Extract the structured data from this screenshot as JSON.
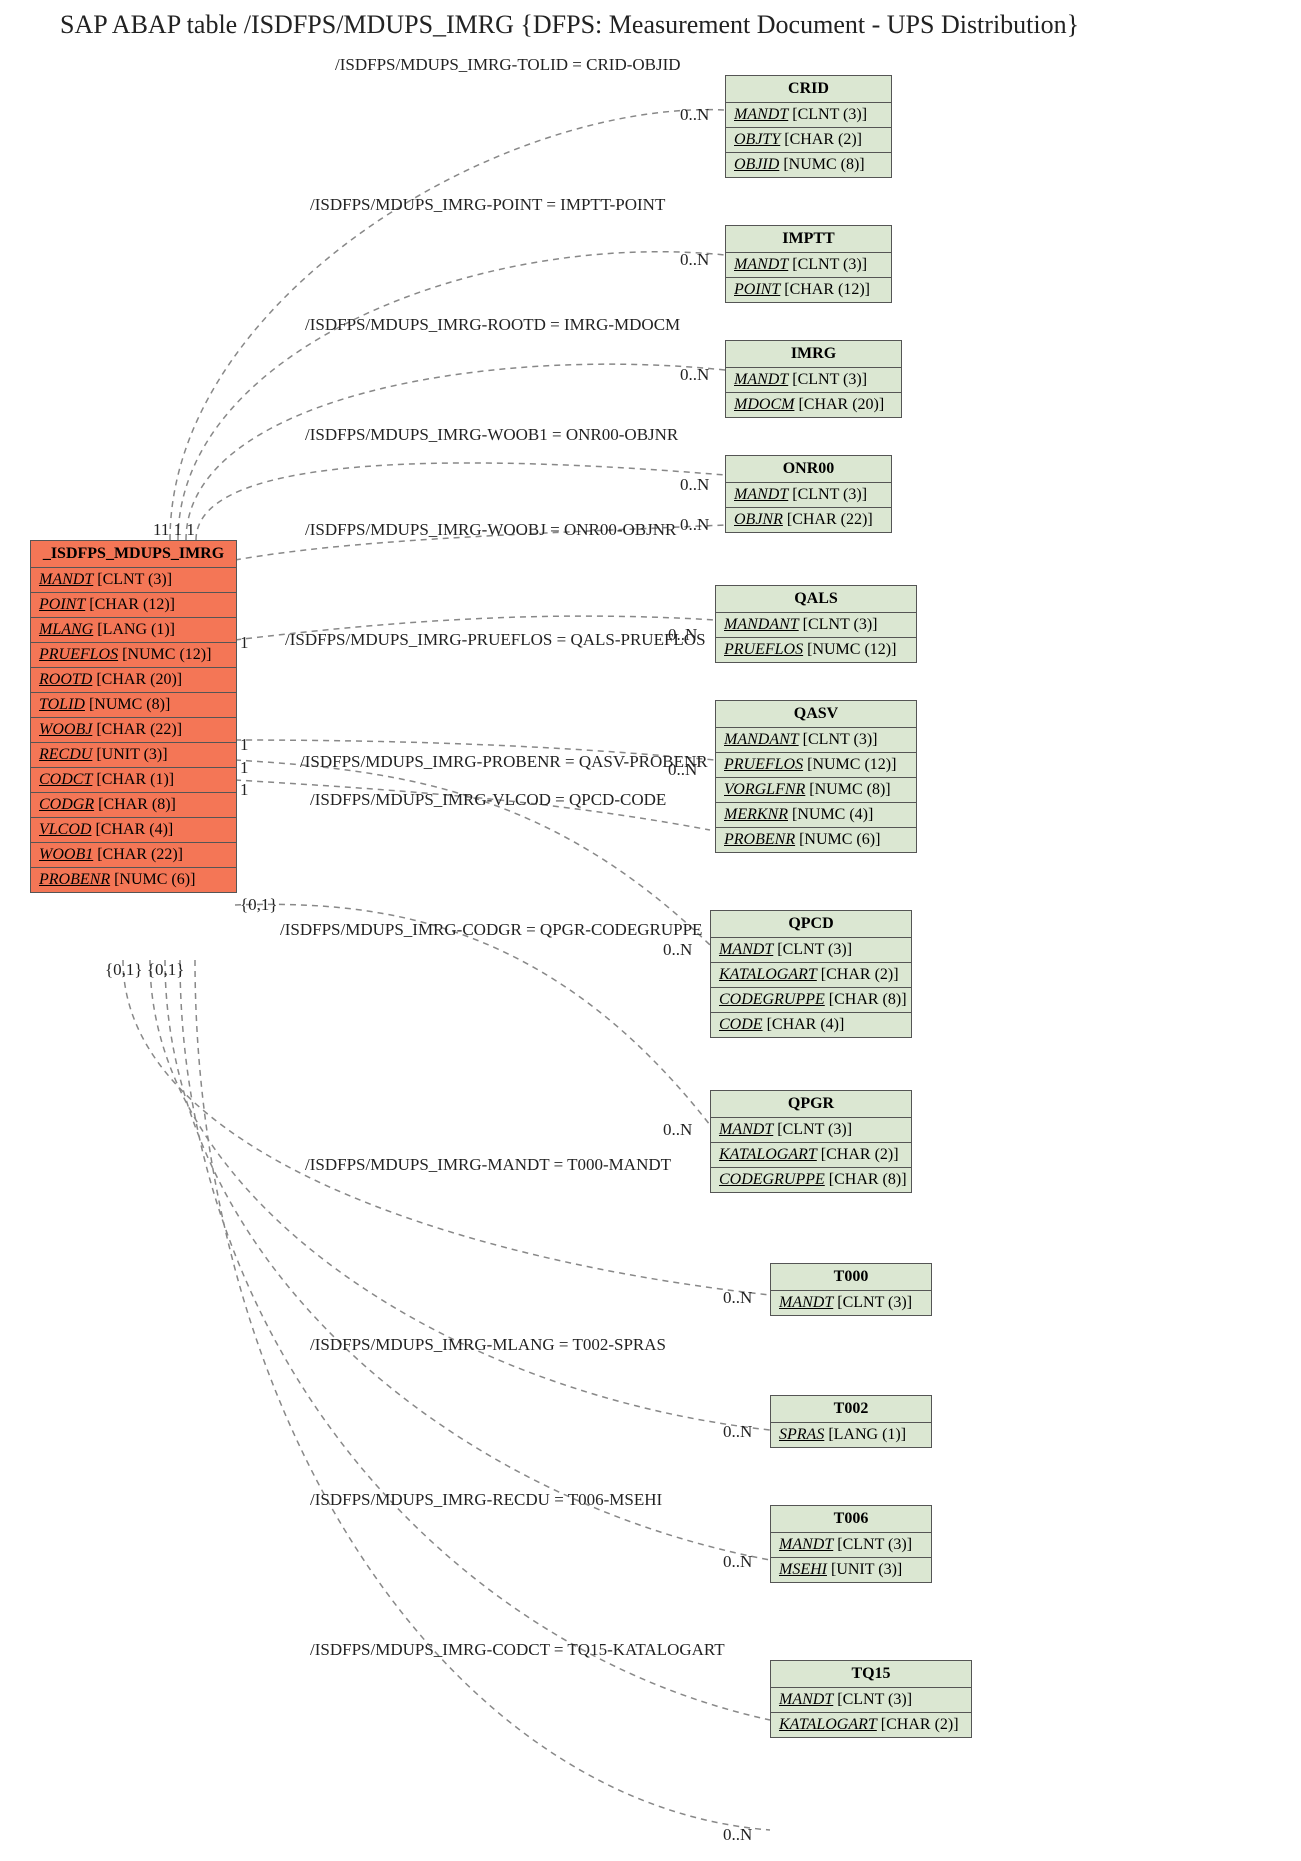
{
  "title": "SAP ABAP table /ISDFPS/MDUPS_IMRG {DFPS: Measurement Document - UPS Distribution}",
  "main_entity": {
    "name": "_ISDFPS_MDUPS_IMRG",
    "fields": [
      {
        "name": "MANDT",
        "type": "[CLNT (3)]",
        "key": true
      },
      {
        "name": "POINT",
        "type": "[CHAR (12)]",
        "key": true
      },
      {
        "name": "MLANG",
        "type": "[LANG (1)]",
        "key": true
      },
      {
        "name": "PRUEFLOS",
        "type": "[NUMC (12)]",
        "key": true
      },
      {
        "name": "ROOTD",
        "type": "[CHAR (20)]",
        "key": true
      },
      {
        "name": "TOLID",
        "type": "[NUMC (8)]",
        "key": true
      },
      {
        "name": "WOOBJ",
        "type": "[CHAR (22)]",
        "key": true
      },
      {
        "name": "RECDU",
        "type": "[UNIT (3)]",
        "key": true
      },
      {
        "name": "CODCT",
        "type": "[CHAR (1)]",
        "key": true
      },
      {
        "name": "CODGR",
        "type": "[CHAR (8)]",
        "key": true
      },
      {
        "name": "VLCOD",
        "type": "[CHAR (4)]",
        "key": true
      },
      {
        "name": "WOOB1",
        "type": "[CHAR (22)]",
        "key": true
      },
      {
        "name": "PROBENR",
        "type": "[NUMC (6)]",
        "key": true
      }
    ]
  },
  "related": [
    {
      "name": "CRID",
      "fields": [
        {
          "name": "MANDT",
          "type": "[CLNT (3)]",
          "key": true
        },
        {
          "name": "OBJTY",
          "type": "[CHAR (2)]",
          "key": true
        },
        {
          "name": "OBJID",
          "type": "[NUMC (8)]",
          "key": true
        }
      ]
    },
    {
      "name": "IMPTT",
      "fields": [
        {
          "name": "MANDT",
          "type": "[CLNT (3)]",
          "key": true
        },
        {
          "name": "POINT",
          "type": "[CHAR (12)]",
          "key": true
        }
      ]
    },
    {
      "name": "IMRG",
      "fields": [
        {
          "name": "MANDT",
          "type": "[CLNT (3)]",
          "key": true
        },
        {
          "name": "MDOCM",
          "type": "[CHAR (20)]",
          "key": true
        }
      ]
    },
    {
      "name": "ONR00",
      "fields": [
        {
          "name": "MANDT",
          "type": "[CLNT (3)]",
          "key": true
        },
        {
          "name": "OBJNR",
          "type": "[CHAR (22)]",
          "key": true
        }
      ]
    },
    {
      "name": "QALS",
      "fields": [
        {
          "name": "MANDANT",
          "type": "[CLNT (3)]",
          "key": true
        },
        {
          "name": "PRUEFLOS",
          "type": "[NUMC (12)]",
          "key": true
        }
      ]
    },
    {
      "name": "QASV",
      "fields": [
        {
          "name": "MANDANT",
          "type": "[CLNT (3)]",
          "key": true
        },
        {
          "name": "PRUEFLOS",
          "type": "[NUMC (12)]",
          "key": true
        },
        {
          "name": "VORGLFNR",
          "type": "[NUMC (8)]",
          "key": true
        },
        {
          "name": "MERKNR",
          "type": "[NUMC (4)]",
          "key": true
        },
        {
          "name": "PROBENR",
          "type": "[NUMC (6)]",
          "key": true
        }
      ]
    },
    {
      "name": "QPCD",
      "fields": [
        {
          "name": "MANDT",
          "type": "[CLNT (3)]",
          "key": true
        },
        {
          "name": "KATALOGART",
          "type": "[CHAR (2)]",
          "key": true
        },
        {
          "name": "CODEGRUPPE",
          "type": "[CHAR (8)]",
          "key": true
        },
        {
          "name": "CODE",
          "type": "[CHAR (4)]",
          "key": true
        }
      ]
    },
    {
      "name": "QPGR",
      "fields": [
        {
          "name": "MANDT",
          "type": "[CLNT (3)]",
          "key": true
        },
        {
          "name": "KATALOGART",
          "type": "[CHAR (2)]",
          "key": true
        },
        {
          "name": "CODEGRUPPE",
          "type": "[CHAR (8)]",
          "key": true
        }
      ]
    },
    {
      "name": "T000",
      "fields": [
        {
          "name": "MANDT",
          "type": "[CLNT (3)]",
          "key": true
        }
      ]
    },
    {
      "name": "T002",
      "fields": [
        {
          "name": "SPRAS",
          "type": "[LANG (1)]",
          "key": true
        }
      ]
    },
    {
      "name": "T006",
      "fields": [
        {
          "name": "MANDT",
          "type": "[CLNT (3)]",
          "key": true
        },
        {
          "name": "MSEHI",
          "type": "[UNIT (3)]",
          "key": true
        }
      ]
    },
    {
      "name": "TQ15",
      "fields": [
        {
          "name": "MANDT",
          "type": "[CLNT (3)]",
          "key": true
        },
        {
          "name": "KATALOGART",
          "type": "[CHAR (2)]",
          "key": true
        }
      ]
    }
  ],
  "edges": [
    {
      "label": "/ISDFPS/MDUPS_IMRG-TOLID = CRID-OBJID",
      "left_card": "1",
      "right_card": "0..N"
    },
    {
      "label": "/ISDFPS/MDUPS_IMRG-POINT = IMPTT-POINT",
      "left_card": "1",
      "right_card": "0..N"
    },
    {
      "label": "/ISDFPS/MDUPS_IMRG-ROOTD = IMRG-MDOCM",
      "left_card": "1",
      "right_card": "0..N"
    },
    {
      "label": "/ISDFPS/MDUPS_IMRG-WOOB1 = ONR00-OBJNR",
      "left_card": "1",
      "right_card": "0..N"
    },
    {
      "label": "/ISDFPS/MDUPS_IMRG-WOOBJ = ONR00-OBJNR",
      "left_card": "1",
      "right_card": "0..N"
    },
    {
      "label": "/ISDFPS/MDUPS_IMRG-PRUEFLOS = QALS-PRUEFLOS",
      "left_card": "1",
      "right_card": "0..N"
    },
    {
      "label": "/ISDFPS/MDUPS_IMRG-PROBENR = QASV-PROBENR",
      "left_card": "1",
      "right_card": "0..N"
    },
    {
      "label": "/ISDFPS/MDUPS_IMRG-VLCOD = QPCD-CODE",
      "left_card": "1",
      "right_card": "0..N"
    },
    {
      "label": "/ISDFPS/MDUPS_IMRG-CODGR = QPGR-CODEGRUPPE",
      "left_card": "{0,1}",
      "right_card": "0..N"
    },
    {
      "label": "/ISDFPS/MDUPS_IMRG-MANDT = T000-MANDT",
      "left_card": "{0,1}",
      "right_card": "0..N"
    },
    {
      "label": "/ISDFPS/MDUPS_IMRG-MLANG = T002-SPRAS",
      "left_card": "{0,1}",
      "right_card": "0..N"
    },
    {
      "label": "/ISDFPS/MDUPS_IMRG-RECDU = T006-MSEHI",
      "left_card": "{0,1}",
      "right_card": "0..N"
    },
    {
      "label": "/ISDFPS/MDUPS_IMRG-CODCT = TQ15-KATALOGART",
      "left_card": "",
      "right_card": "0..N"
    }
  ],
  "left_cards_block": "11  1     1",
  "left_cards_bottom": "{0,1} {0,1}"
}
